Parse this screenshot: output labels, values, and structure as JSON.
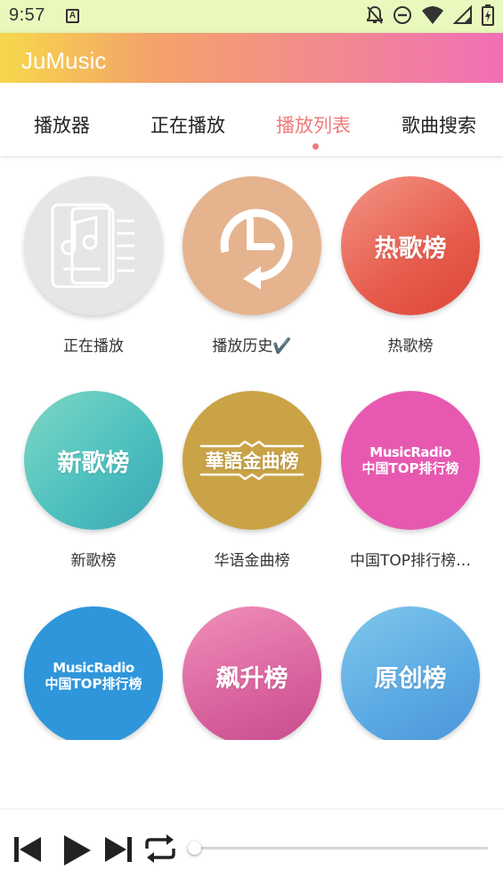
{
  "status_bar": {
    "time": "9:57",
    "notification_glyph": "A",
    "icons": [
      "notifications-off-icon",
      "do-not-disturb-icon",
      "wifi-icon",
      "signal-icon",
      "battery-charging-icon"
    ]
  },
  "app": {
    "title": "JuMusic",
    "colors": {
      "accent": "#f07a7a",
      "header_start": "#f6d84a",
      "header_end": "#f26fb5"
    }
  },
  "tabs": [
    {
      "label": "播放器",
      "active": false
    },
    {
      "label": "正在播放",
      "active": false
    },
    {
      "label": "播放列表",
      "active": true
    },
    {
      "label": "歌曲搜索",
      "active": false
    }
  ],
  "grid": {
    "items": [
      {
        "label": "正在播放",
        "icon": "playlist-document-icon"
      },
      {
        "label": "播放历史✔️",
        "icon": "history-clock-icon"
      },
      {
        "label": "热歌榜",
        "cover_text": "热歌榜"
      },
      {
        "label": "新歌榜",
        "cover_text": "新歌榜"
      },
      {
        "label": "华语金曲榜",
        "cover_text": "華語金曲榜"
      },
      {
        "label": "中国TOP排行榜…",
        "cover_line1": "MusicRadio",
        "cover_line2": "中国TOP排行榜"
      },
      {
        "label": "",
        "cover_line1": "MusicRadio",
        "cover_line2": "中国TOP排行榜"
      },
      {
        "label": "",
        "cover_text": "飙升榜"
      },
      {
        "label": "",
        "cover_text": "原创榜"
      }
    ]
  },
  "player": {
    "controls": [
      "skip-previous-icon",
      "play-icon",
      "skip-next-icon",
      "repeat-icon"
    ],
    "progress": 0
  }
}
